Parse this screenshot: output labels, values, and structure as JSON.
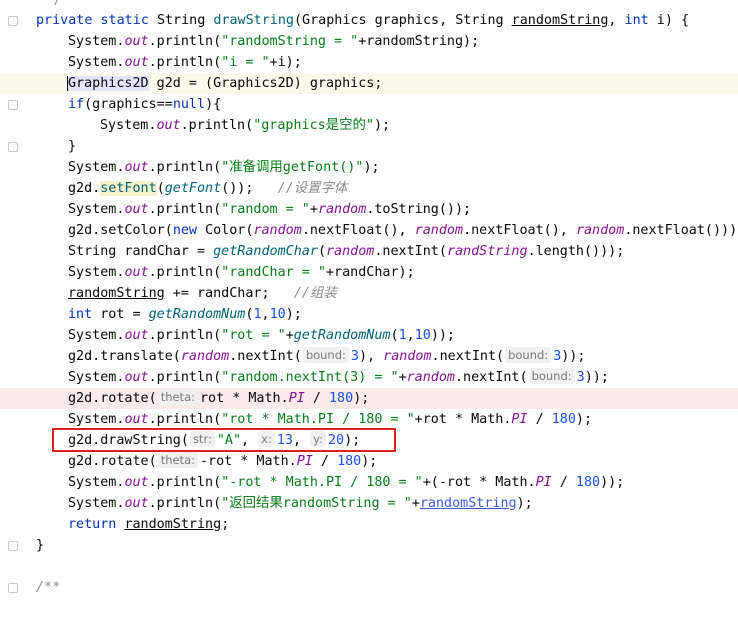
{
  "editor": {
    "top_comment": "*/",
    "signature": {
      "mods": "private static",
      "ret": "String",
      "name": "drawString",
      "params_a": "(Graphics graphics, String ",
      "p_random": "randomString",
      "params_b": ", ",
      "kw_int": "int",
      "params_c": " i) {"
    },
    "l1": {
      "pre": "System.",
      "out": "out",
      "call": ".println(",
      "s": "\"randomString = \"",
      "rest": "+randomString);"
    },
    "l2": {
      "pre": "System.",
      "out": "out",
      "call": ".println(",
      "s": "\"i = \"",
      "rest": "+i);"
    },
    "l3": {
      "type": "Graphics2D",
      "rest": " g2d = (Graphics2D) graphics;"
    },
    "l4": {
      "kw": "if",
      "a": "(graphics==",
      "null": "null",
      "b": "){"
    },
    "l5": {
      "pre": "System.",
      "out": "out",
      "call": ".println(",
      "s": "\"graphics是空的\"",
      "rest": ");"
    },
    "l6": {
      "text": "}"
    },
    "l7": {
      "pre": "System.",
      "out": "out",
      "call": ".println(",
      "s": "\"准备调用getFont()\"",
      "rest": ");"
    },
    "l8": {
      "a": "g2d.",
      "fn": "setFont",
      "b": "(",
      "gf": "getFont",
      "c": "());   ",
      "cmt": "//设置字体"
    },
    "l9": {
      "pre": "System.",
      "out": "out",
      "call": ".println(",
      "s": "\"random = \"",
      "plus": "+",
      "rnd": "random",
      "rest": ".toString());"
    },
    "l10": {
      "a": "g2d.setColor(",
      "kw": "new",
      "b": " Color(",
      "r1": "random",
      "c": ".nextFloat(), ",
      "r2": "random",
      "d": ".nextFloat(), ",
      "r3": "random",
      "e": ".nextFloat()));"
    },
    "l11": {
      "a": "String randChar = ",
      "fn": "getRandomChar",
      "b": "(",
      "rnd": "random",
      "c": ".nextInt(",
      "rs": "randString",
      "d": ".length()));"
    },
    "l12": {
      "pre": "System.",
      "out": "out",
      "call": ".println(",
      "s": "\"randChar = \"",
      "rest": "+randChar);"
    },
    "l13": {
      "v": "randomString",
      "b": " += randChar;   ",
      "cmt": "//组装"
    },
    "l14": {
      "kw": "int",
      "a": " rot = ",
      "fn": "getRandomNum",
      "b": "(",
      "n1": "1",
      "c": ",",
      "n2": "10",
      "d": ");"
    },
    "l15": {
      "pre": "System.",
      "out": "out",
      "call": ".println(",
      "s": "\"rot = \"",
      "plus": "+",
      "fn": "getRandomNum",
      "b": "(",
      "n1": "1",
      "c": ",",
      "n2": "10",
      "d": "));"
    },
    "l16": {
      "a": "g2d.translate(",
      "r1": "random",
      "b": ".nextInt(",
      "h1": "bound:",
      "n1": "3",
      "c": "), ",
      "r2": "random",
      "d": ".nextInt(",
      "h2": "bound:",
      "n2": "3",
      "e": "));"
    },
    "l17": {
      "pre": "System.",
      "out": "out",
      "call": ".println(",
      "s": "\"random.nextInt(3) = \"",
      "plus": "+",
      "rnd": "random",
      "b": ".nextInt(",
      "h": "bound:",
      "n": "3",
      "c": "));"
    },
    "l18": {
      "a": "g2d.rotate(",
      "h": "theta:",
      "b": "rot * Math.",
      "pi": "PI",
      "c": " / ",
      "n": "180",
      "d": ");"
    },
    "l19": {
      "pre": "System.",
      "out": "out",
      "call": ".println(",
      "s": "\"rot * Math.PI / 180 = \"",
      "a": "+rot * Math.",
      "pi": "PI",
      "c": " / ",
      "n": "180",
      "d": ");"
    },
    "l20": {
      "a": "g2d.drawString(",
      "h1": "str:",
      "s": "\"A\"",
      "b": ", ",
      "h2": "x:",
      "n1": "13",
      "c": ", ",
      "h3": "y:",
      "n2": "20",
      "d": ");"
    },
    "l21": {
      "a": "g2d.rotate(",
      "h": "theta:",
      "b": "-rot * Math.",
      "pi": "PI",
      "c": " / ",
      "n": "180",
      "d": ");"
    },
    "l22": {
      "pre": "System.",
      "out": "out",
      "call": ".println(",
      "s": "\"-rot * Math.PI / 180 = \"",
      "a": "+(-rot * Math.",
      "pi": "PI",
      "c": " / ",
      "n": "180",
      "d": "));"
    },
    "l23": {
      "pre": "System.",
      "out": "out",
      "call": ".println(",
      "s": "\"返回结果randomString = \"",
      "plus": "+",
      "v": "randomString",
      "d": ");"
    },
    "l24": {
      "kw": "return",
      "sp": " ",
      "v": "randomString",
      "d": ";"
    },
    "l25": {
      "text": "}"
    },
    "l26": {
      "text": "/**"
    }
  },
  "colors": {
    "keyword": "#0033b3",
    "string": "#067d17",
    "number": "#1750eb",
    "field": "#871094",
    "method": "#00627a",
    "comment": "#8c8c8c",
    "highlight_box": "#e0201a"
  }
}
